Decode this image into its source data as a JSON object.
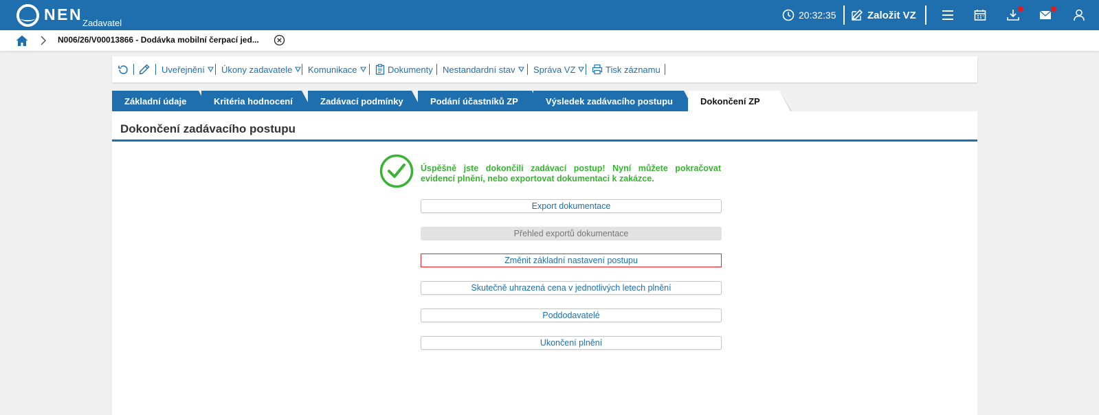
{
  "app": {
    "logo_text": "NEN",
    "logo_sub": "Zadavatel",
    "time": "20:32:35",
    "new_label": "Založit VZ"
  },
  "breadcrumb": {
    "current": "N006/26/V00013866 - Dodávka mobilní čerpací jed..."
  },
  "toolbar": {
    "items": [
      "Uveřejnění",
      "Úkony zadavatele",
      "Komunikace",
      "Dokumenty",
      "Nestandardní stav",
      "Správa VZ",
      "Tisk záznamu"
    ]
  },
  "tabs": [
    {
      "label": "Základní údaje"
    },
    {
      "label": "Kritéria hodnocení"
    },
    {
      "label": "Zadávací podmínky"
    },
    {
      "label": "Podání účastníků ZP"
    },
    {
      "label": "Výsledek zadávacího postupu"
    },
    {
      "label": "Dokončení ZP"
    }
  ],
  "main": {
    "title": "Dokončení zadávacího postupu",
    "success_message": "Úspěšně jste dokončili zadávací postup! Nyní můžete pokračovat evidencí plnění, nebo exportovat dokumentaci k zakázce.",
    "buttons": [
      {
        "label": "Export dokumentace"
      },
      {
        "label": "Přehled exportů dokumentace"
      },
      {
        "label": "Změnit základní nastavení postupu"
      },
      {
        "label": "Skutečně uhrazená cena v jednotlivých letech plnění"
      },
      {
        "label": "Poddodavatelé"
      },
      {
        "label": "Ukončení plnění"
      }
    ]
  },
  "colors": {
    "brand": "#1f6fae",
    "success": "#3ab234",
    "alert": "#e31c1c"
  }
}
